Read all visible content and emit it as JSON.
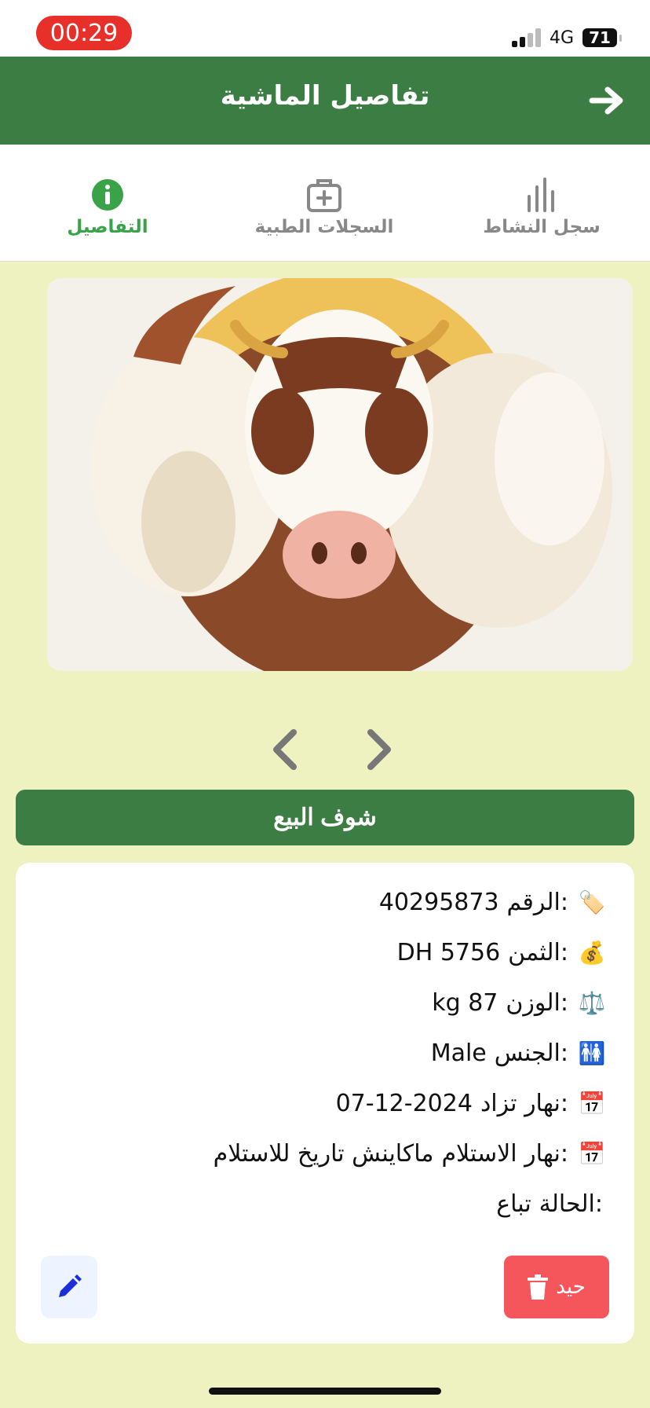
{
  "status_bar": {
    "time": "00:29",
    "network": "4G",
    "battery": "71"
  },
  "header": {
    "title": "تفاصيل الماشية",
    "back_icon": "arrow-right-icon"
  },
  "tabs": [
    {
      "label": "سجل النشاط",
      "icon": "bar-chart-icon",
      "active": false
    },
    {
      "label": "السجلات الطبية",
      "icon": "medical-kit-icon",
      "active": false
    },
    {
      "label": "التفاصيل",
      "icon": "info-icon",
      "active": true
    }
  ],
  "image_carousel": {
    "prev_icon": "chevron-left-icon",
    "next_icon": "chevron-right-icon"
  },
  "primary_action": {
    "label": "شوف البيع"
  },
  "details": [
    {
      "icon": "tag-icon",
      "label": "الرقم:",
      "value": "40295873"
    },
    {
      "icon": "money-bag-icon",
      "label": "الثمن:",
      "value": "DH 5756"
    },
    {
      "icon": "scale-icon",
      "label": "الوزن:",
      "value": "kg 87"
    },
    {
      "icon": "restroom-icon",
      "label": "الجنس:",
      "value": "Male"
    },
    {
      "icon": "calendar-icon",
      "label": "نهار تزاد:",
      "value": "07-12-2024"
    },
    {
      "icon": "calendar-icon",
      "label": "نهار الاستلام:",
      "value": "ماكاينش تاريخ للاستلام"
    },
    {
      "icon": "",
      "label": "الحالة:",
      "value": "تباع"
    }
  ],
  "actions": {
    "delete_label": "حيد",
    "delete_icon": "trash-icon",
    "edit_icon": "pencil-icon"
  },
  "colors": {
    "header": "#3b7d43",
    "active_tab": "#3aa34a",
    "background": "#eef2c0",
    "delete": "#f4565c",
    "edit_icon": "#1c2ed8"
  }
}
